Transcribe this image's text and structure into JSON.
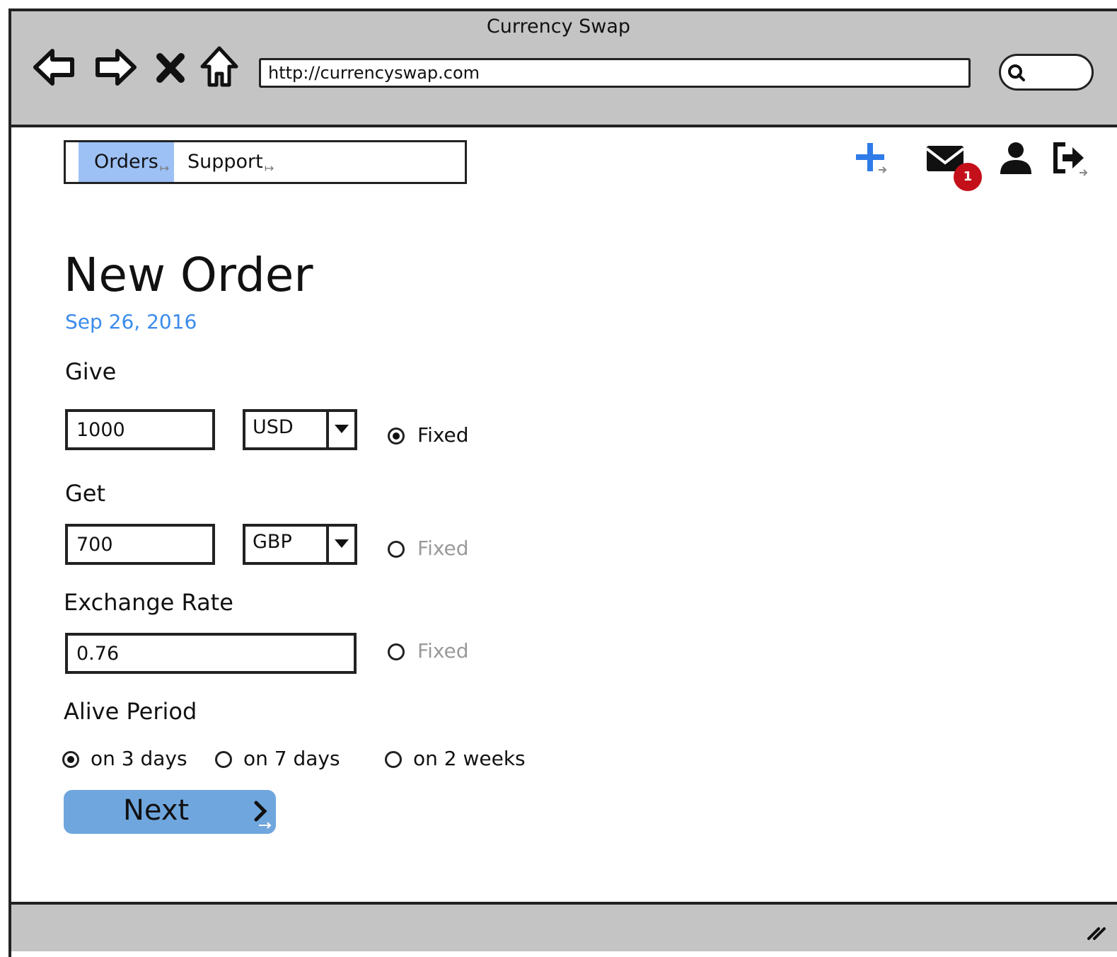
{
  "browser": {
    "title": "Currency Swap",
    "url": "http://currencyswap.com"
  },
  "nav": {
    "tabs": [
      {
        "label": "Orders",
        "active": true
      },
      {
        "label": "Support",
        "active": false
      }
    ],
    "icons": [
      "add-icon",
      "mail-icon",
      "user-icon",
      "logout-icon"
    ],
    "mail_badge": "1"
  },
  "colors": {
    "accent": "#3b8beb",
    "active_tab": "#9dc1f5",
    "button": "#6fa6dd",
    "badge": "#c4101a",
    "chrome": "#c4c4c4"
  },
  "form": {
    "title": "New Order",
    "date": "Sep 26, 2016",
    "give": {
      "label": "Give",
      "amount": "1000",
      "currency": "USD",
      "fixed_label": "Fixed",
      "fixed": true
    },
    "get": {
      "label": "Get",
      "amount": "700",
      "currency": "GBP",
      "fixed_label": "Fixed",
      "fixed": false
    },
    "rate": {
      "label": "Exchange Rate",
      "value": "0.76",
      "fixed_label": "Fixed",
      "fixed": false
    },
    "alive": {
      "label": "Alive Period",
      "options": [
        {
          "label": "on 3 days",
          "selected": true
        },
        {
          "label": "on 7 days",
          "selected": false
        },
        {
          "label": "on 2 weeks",
          "selected": false
        }
      ]
    },
    "next_label": "Next"
  }
}
